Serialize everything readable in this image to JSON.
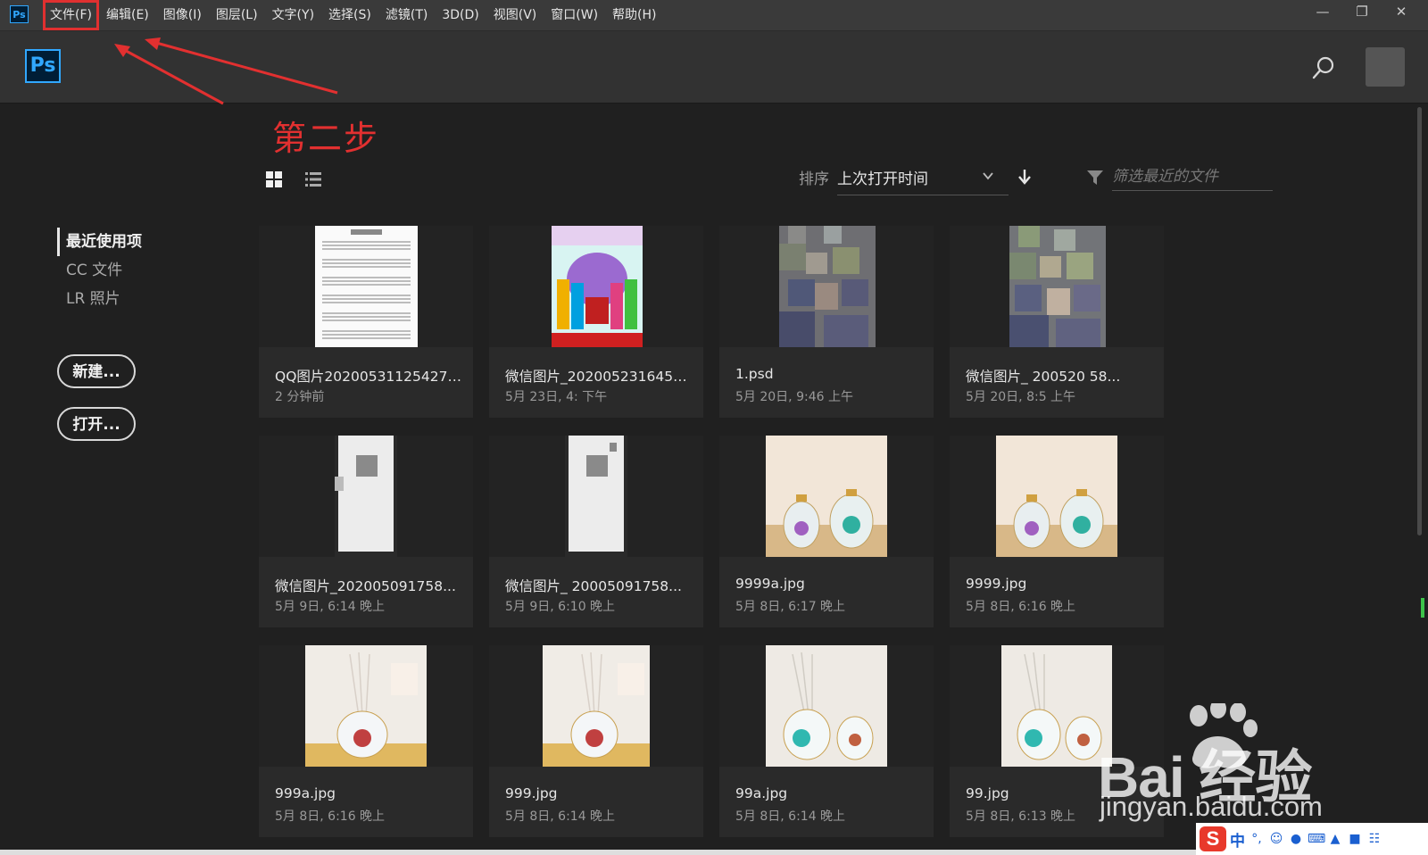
{
  "menubar": {
    "app_logo": "Ps",
    "items": [
      "文件(F)",
      "编辑(E)",
      "图像(I)",
      "图层(L)",
      "文字(Y)",
      "选择(S)",
      "滤镜(T)",
      "3D(D)",
      "视图(V)",
      "窗口(W)",
      "帮助(H)"
    ],
    "window_controls": [
      "minimize-icon",
      "restore-icon",
      "close-icon"
    ]
  },
  "header": {
    "logo": "Ps",
    "icons": [
      "search-icon",
      "avatar"
    ]
  },
  "annotation": {
    "text": "第二步",
    "color": "#e23030"
  },
  "toolbar": {
    "view_modes": [
      "grid-view-icon",
      "list-view-icon"
    ],
    "sort_label": "排序",
    "sort_value": "上次打开时间",
    "filter_placeholder": "筛选最近的文件"
  },
  "sidebar": {
    "items": [
      {
        "label": "最近使用项",
        "active": true
      },
      {
        "label": "CC 文件",
        "active": false
      },
      {
        "label": "LR 照片",
        "active": false
      }
    ],
    "new_button": "新建...",
    "open_button": "打开..."
  },
  "files": [
    {
      "name": "QQ图片20200531125427.jpg",
      "time": "2 分钟前",
      "thumb": "sheet"
    },
    {
      "name": "微信图片_2020052316451...",
      "time": "5月 23日, 4:   下午",
      "thumb": "product"
    },
    {
      "name": "1.psd",
      "time": "5月 20日, 9:46 上午",
      "thumb": "blur"
    },
    {
      "name": "微信图片_  200520   58...",
      "time": "5月 20日, 8:5  上午",
      "thumb": "blur"
    },
    {
      "name": "微信图片_202005091758...",
      "time": "5月 9日, 6:14 晚上",
      "thumb": "white"
    },
    {
      "name": "微信图片_  20005091758...",
      "time": "5月 9日, 6:10 晚上",
      "thumb": "white"
    },
    {
      "name": "9999a.jpg",
      "time": "5月 8日, 6:17 晚上",
      "thumb": "flower"
    },
    {
      "name": "9999.jpg",
      "time": "5月 8日, 6:16 晚上",
      "thumb": "flower"
    },
    {
      "name": "999a.jpg",
      "time": "5月 8日, 6:16 晚上",
      "thumb": "diffuser"
    },
    {
      "name": "999.jpg",
      "time": "5月 8日, 6:14 晚上",
      "thumb": "diffuser"
    },
    {
      "name": "99a.jpg",
      "time": "5月 8日, 6:14 晚上",
      "thumb": "teal"
    },
    {
      "name": "99.jpg",
      "time": "5月 8日, 6:13 晚上",
      "thumb": "teal"
    }
  ],
  "watermark": {
    "brand": "Bai 经验",
    "url": "jingyan.baidu.com"
  },
  "ime": {
    "logo": "S",
    "mode": "中"
  },
  "colors": {
    "accent": "#31a8ff",
    "highlight": "#e03030",
    "background": "#202020"
  }
}
